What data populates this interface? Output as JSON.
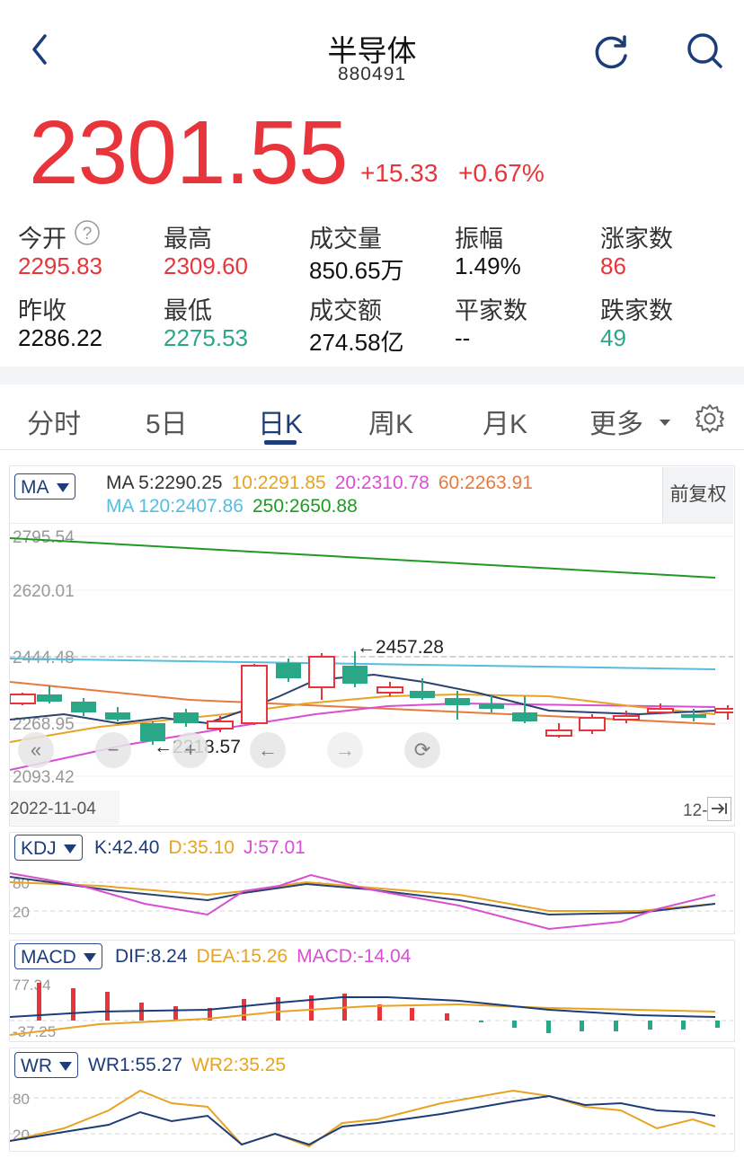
{
  "header": {
    "title": "半导体",
    "code": "880491",
    "back_icon": "chevron-left-icon",
    "refresh_icon": "refresh-icon",
    "search_icon": "search-icon"
  },
  "quote": {
    "price": "2301.55",
    "change": "+15.33",
    "change_pct": "+0.67%"
  },
  "stats": [
    {
      "label": "今开",
      "value": "2295.83",
      "color": "red"
    },
    {
      "label": "最高",
      "value": "2309.60",
      "color": "red"
    },
    {
      "label": "成交量",
      "value": "850.65万",
      "color": "black"
    },
    {
      "label": "振幅",
      "value": "1.49%",
      "color": "black"
    },
    {
      "label": "涨家数",
      "value": "86",
      "color": "red"
    },
    {
      "label": "昨收",
      "value": "2286.22",
      "color": "black"
    },
    {
      "label": "最低",
      "value": "2275.53",
      "color": "green"
    },
    {
      "label": "成交额",
      "value": "274.58亿",
      "color": "black"
    },
    {
      "label": "平家数",
      "value": "--",
      "color": "black"
    },
    {
      "label": "跌家数",
      "value": "49",
      "color": "green"
    }
  ],
  "tabs": [
    "分时",
    "5日",
    "日K",
    "周K",
    "月K",
    "更多"
  ],
  "active_tab": "日K",
  "kline": {
    "selector": "MA",
    "adjust": "前复权",
    "ma_line1": [
      {
        "text": "MA 5:2290.25",
        "color": "#333333"
      },
      {
        "text": "10:2291.85",
        "color": "#e8a321"
      },
      {
        "text": "20:2310.78",
        "color": "#d84fd2"
      },
      {
        "text": "60:2263.91",
        "color": "#e67a3c"
      }
    ],
    "ma_line2": [
      {
        "text": "MA 120:2407.86",
        "color": "#55bde0"
      },
      {
        "text": "250:2650.88",
        "color": "#1f9a22"
      }
    ],
    "y_labels": [
      "2795.54",
      "2620.01",
      "2444.48",
      "2268.95",
      "2093.42"
    ],
    "high_mark": "←2457.28",
    "low_mark": "←2218.57",
    "date_start": "2022-11-04",
    "date_end": "12-",
    "colors": {
      "up": "#e8353c",
      "down": "#2aa786",
      "ma5": "#2b4270",
      "ma10": "#e8a321",
      "ma20": "#d84fd2",
      "ma60": "#e67a3c",
      "ma120": "#55bde0",
      "ma250": "#1f9a22"
    }
  },
  "kdj": {
    "selector": "KDJ",
    "values": [
      {
        "text": "K:42.40",
        "color": "#1d3c7a"
      },
      {
        "text": "D:35.10",
        "color": "#e8a321"
      },
      {
        "text": "J:57.01",
        "color": "#d84fd2"
      }
    ],
    "y_labels": [
      "80",
      "20"
    ]
  },
  "macd": {
    "selector": "MACD",
    "values": [
      {
        "text": "DIF:8.24",
        "color": "#1d3c7a"
      },
      {
        "text": "DEA:15.26",
        "color": "#e8a321"
      },
      {
        "text": "MACD:-14.04",
        "color": "#d84fd2"
      }
    ],
    "y_labels": [
      "77.34",
      "-37.25"
    ]
  },
  "wr": {
    "selector": "WR",
    "values": [
      {
        "text": "WR1:55.27",
        "color": "#1d3c7a"
      },
      {
        "text": "WR2:35.25",
        "color": "#e8a321"
      }
    ],
    "y_labels": [
      "80",
      "20"
    ]
  }
}
